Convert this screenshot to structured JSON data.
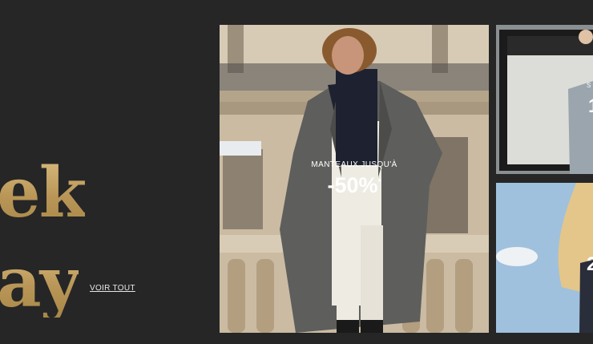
{
  "promo": {
    "line1": "ek",
    "line2": "ay",
    "see_all_label": "VOIR TOUT"
  },
  "main_tile": {
    "caption": "MANTEAUX JUSQU'À",
    "percent": "-50%",
    "asterisk": "*"
  },
  "side_tiles": {
    "top_partial_small": "S",
    "top_partial_big": "1",
    "bottom_partial_big": "2"
  },
  "colors": {
    "background": "#262626",
    "gold": "#c5a76a",
    "caption": "#ffffff"
  }
}
